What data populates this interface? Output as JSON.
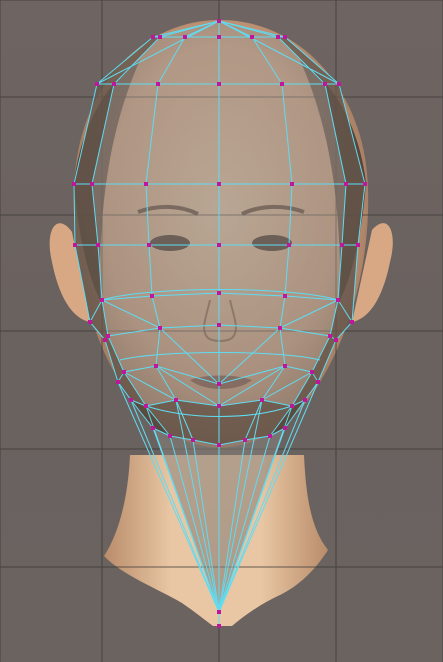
{
  "viewport": {
    "view": "front",
    "grid_visible": true,
    "wireframe_visible": true,
    "vertices_visible": true
  },
  "colors": {
    "background": "#6c6461",
    "grid": "#3a3634",
    "wire": "#5fdcf2",
    "vertex": "#c0169e",
    "skin_light": "#f2d3b4",
    "skin_mid": "#d9aa83",
    "skin_shadow": "#5d4537",
    "hair": "#4a3a31"
  },
  "icons": {
    "vertex_marker": "square-dot",
    "reference_image": "face-reference"
  }
}
